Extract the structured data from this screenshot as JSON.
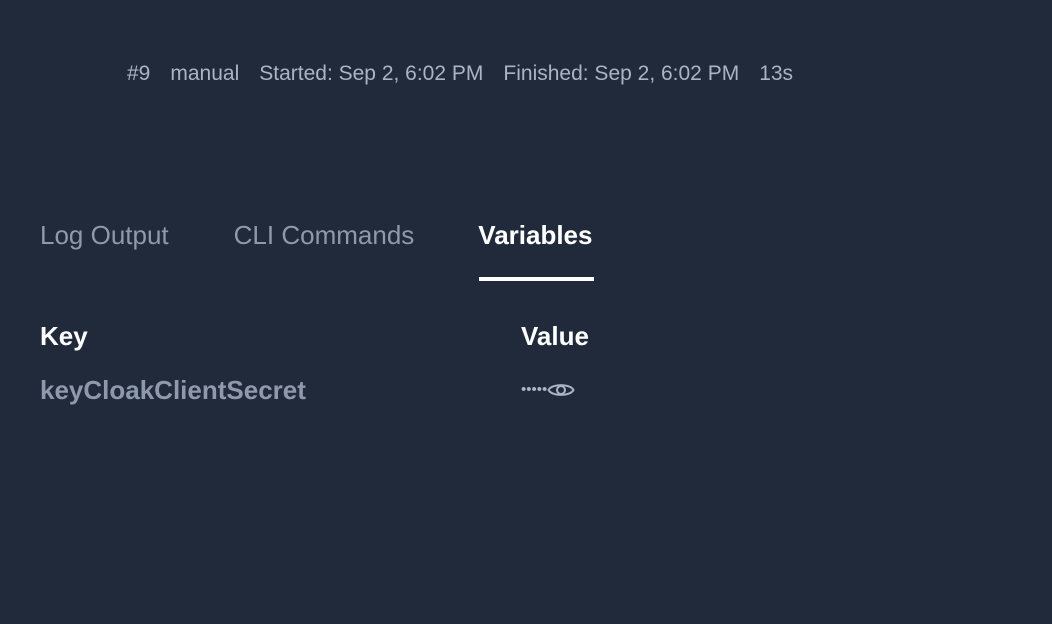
{
  "run": {
    "number": "#9",
    "trigger": "manual",
    "started": "Started: Sep 2, 6:02 PM",
    "finished": "Finished: Sep 2, 6:02 PM",
    "duration": "13s"
  },
  "tabs": [
    {
      "label": "Log Output",
      "active": false
    },
    {
      "label": "CLI Commands",
      "active": false
    },
    {
      "label": "Variables",
      "active": true
    }
  ],
  "table": {
    "headers": {
      "key": "Key",
      "value": "Value"
    },
    "rows": [
      {
        "key": "keyCloakClientSecret",
        "value_masked": "•••••",
        "icon": "eye-icon"
      }
    ]
  },
  "colors": {
    "background": "#212a3b",
    "text_muted": "#a9b4c4",
    "tab_inactive": "#8e9aab",
    "active": "#ffffff"
  }
}
